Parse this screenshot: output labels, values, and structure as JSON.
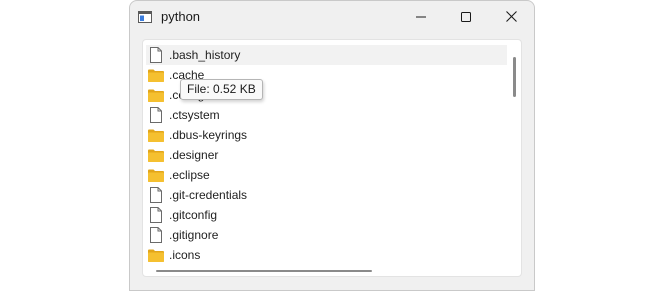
{
  "window": {
    "title": "python"
  },
  "files": [
    {
      "name": ".bash_history",
      "type": "file",
      "icon": "file-icon"
    },
    {
      "name": ".cache",
      "type": "folder",
      "icon": "folder-icon"
    },
    {
      "name": ".config",
      "type": "folder",
      "icon": "folder-icon"
    },
    {
      "name": ".ctsystem",
      "type": "file",
      "icon": "file-icon"
    },
    {
      "name": ".dbus-keyrings",
      "type": "folder",
      "icon": "folder-icon"
    },
    {
      "name": ".designer",
      "type": "folder",
      "icon": "folder-icon"
    },
    {
      "name": ".eclipse",
      "type": "folder",
      "icon": "folder-icon"
    },
    {
      "name": ".git-credentials",
      "type": "file",
      "icon": "file-icon"
    },
    {
      "name": ".gitconfig",
      "type": "file",
      "icon": "file-icon"
    },
    {
      "name": ".gitignore",
      "type": "file",
      "icon": "file-icon"
    },
    {
      "name": ".icons",
      "type": "folder",
      "icon": "folder-icon"
    }
  ],
  "tooltip": {
    "text": "File: 0.52 KB"
  },
  "colors": {
    "folder": "#f5c030",
    "folder_dark": "#e2a61a",
    "selection": "#f2f2f2"
  }
}
